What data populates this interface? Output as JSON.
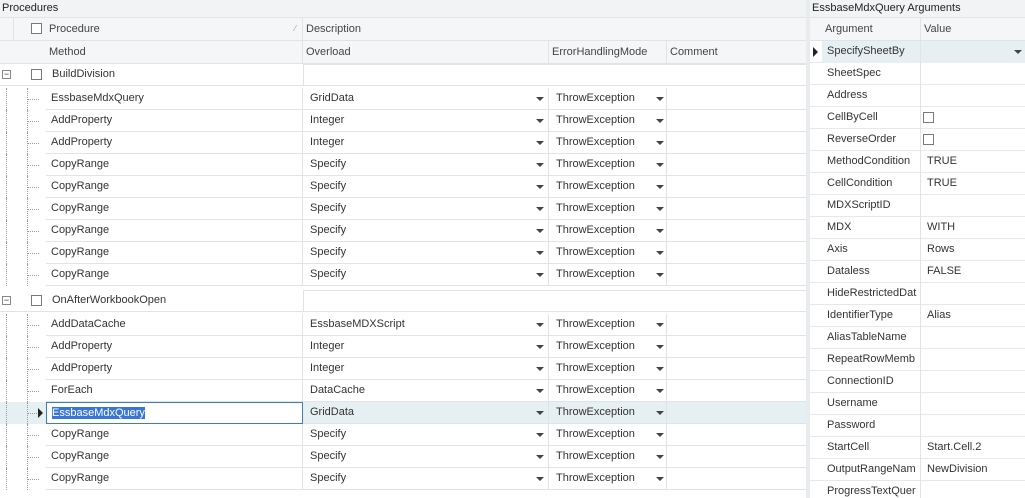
{
  "procedures": {
    "title": "Procedures",
    "header1": {
      "procedure": "Procedure",
      "description": "Description"
    },
    "header2": {
      "method": "Method",
      "overload": "Overload",
      "error_mode": "ErrorHandlingMode",
      "comment": "Comment"
    },
    "groups": [
      {
        "name": "BuildDivision",
        "rows": [
          {
            "method": "EssbaseMdxQuery",
            "overload": "GridData",
            "error_mode": "ThrowException"
          },
          {
            "method": "AddProperty",
            "overload": "Integer",
            "error_mode": "ThrowException"
          },
          {
            "method": "AddProperty",
            "overload": "Integer",
            "error_mode": "ThrowException"
          },
          {
            "method": "CopyRange",
            "overload": "Specify",
            "error_mode": "ThrowException"
          },
          {
            "method": "CopyRange",
            "overload": "Specify",
            "error_mode": "ThrowException"
          },
          {
            "method": "CopyRange",
            "overload": "Specify",
            "error_mode": "ThrowException"
          },
          {
            "method": "CopyRange",
            "overload": "Specify",
            "error_mode": "ThrowException"
          },
          {
            "method": "CopyRange",
            "overload": "Specify",
            "error_mode": "ThrowException"
          },
          {
            "method": "CopyRange",
            "overload": "Specify",
            "error_mode": "ThrowException"
          }
        ]
      },
      {
        "name": "OnAfterWorkbookOpen",
        "rows": [
          {
            "method": "AddDataCache",
            "overload": "EssbaseMDXScript",
            "error_mode": "ThrowException"
          },
          {
            "method": "AddProperty",
            "overload": "Integer",
            "error_mode": "ThrowException"
          },
          {
            "method": "AddProperty",
            "overload": "Integer",
            "error_mode": "ThrowException"
          },
          {
            "method": "ForEach",
            "overload": "DataCache",
            "error_mode": "ThrowException"
          },
          {
            "method": "EssbaseMdxQuery",
            "overload": "GridData",
            "error_mode": "ThrowException",
            "selected": true
          },
          {
            "method": "CopyRange",
            "overload": "Specify",
            "error_mode": "ThrowException"
          },
          {
            "method": "CopyRange",
            "overload": "Specify",
            "error_mode": "ThrowException"
          },
          {
            "method": "CopyRange",
            "overload": "Specify",
            "error_mode": "ThrowException"
          }
        ]
      }
    ]
  },
  "arguments": {
    "title": "EssbaseMdxQuery Arguments",
    "header": {
      "argument": "Argument",
      "value": "Value"
    },
    "rows": [
      {
        "name": "SpecifySheetBy",
        "value": "",
        "type": "dropdown",
        "selected": true
      },
      {
        "name": "SheetSpec",
        "value": ""
      },
      {
        "name": "Address",
        "value": ""
      },
      {
        "name": "CellByCell",
        "value": "",
        "type": "checkbox"
      },
      {
        "name": "ReverseOrder",
        "value": "",
        "type": "checkbox"
      },
      {
        "name": "MethodCondition",
        "value": "TRUE"
      },
      {
        "name": "CellCondition",
        "value": "TRUE"
      },
      {
        "name": "MDXScriptID",
        "value": ""
      },
      {
        "name": "MDX",
        "value": "WITH"
      },
      {
        "name": "Axis",
        "value": "Rows"
      },
      {
        "name": "Dataless",
        "value": "FALSE"
      },
      {
        "name": "HideRestrictedDat",
        "value": ""
      },
      {
        "name": "IdentifierType",
        "value": "Alias"
      },
      {
        "name": "AliasTableName",
        "value": ""
      },
      {
        "name": "RepeatRowMemb",
        "value": ""
      },
      {
        "name": "ConnectionID",
        "value": ""
      },
      {
        "name": "Username",
        "value": ""
      },
      {
        "name": "Password",
        "value": ""
      },
      {
        "name": "StartCell",
        "value": "Start.Cell.2"
      },
      {
        "name": "OutputRangeNam",
        "value": "NewDivision"
      },
      {
        "name": "ProgressTextQuer",
        "value": ""
      }
    ]
  }
}
